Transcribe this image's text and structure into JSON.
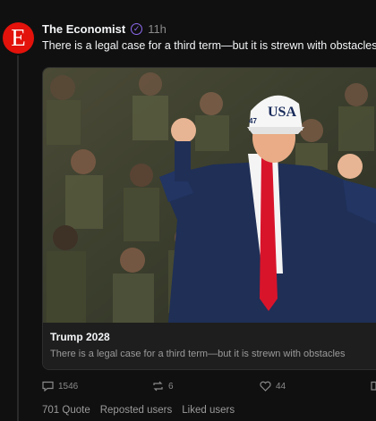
{
  "post": {
    "author": "The Economist",
    "avatar_letter": "E",
    "time": "11h",
    "text": "There is a legal case for a third term—but it is strewn with obstacles"
  },
  "card": {
    "photo_alt": "Man in a navy suit, white shirt and red tie wearing a white USA cap, dancing with raised fists in front of a crowd of people in camouflage uniforms",
    "cap_text": "USA",
    "cap_side_text": "47",
    "title": "Trump 2028",
    "description": "There is a legal case for a third term—but it is strewn with obstacles"
  },
  "actions": {
    "replies": "1546",
    "reposts": "6",
    "likes": "44"
  },
  "footer": {
    "quote": "701 Quote",
    "reposted_users": "Reposted users",
    "liked_users": "Liked users"
  },
  "colors": {
    "background": "#101010",
    "avatar": "#e3120b",
    "verified": "#8f6bf2",
    "tie": "#d8142b",
    "suit": "#1f2f56"
  }
}
